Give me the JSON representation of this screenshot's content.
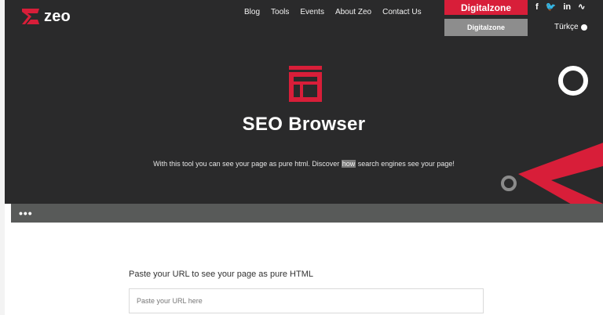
{
  "header": {
    "logo_text": "zeo",
    "nav": [
      "Blog",
      "Tools",
      "Events",
      "About Zeo",
      "Contact Us"
    ],
    "digitalzone_label": "Digitalzone",
    "digitalzone_sub_label": "Digitalzone",
    "social_icons": [
      "facebook-icon",
      "twitter-icon",
      "linkedin-icon",
      "rss-icon"
    ],
    "social_glyphs": [
      "f",
      "🐦",
      "in",
      "∿"
    ],
    "language": "Türkçe"
  },
  "hero": {
    "title": "SEO Browser",
    "subtitle_before": "With this tool you can see your page as pure html. Discover ",
    "subtitle_highlight": "how",
    "subtitle_after": " search engines see your page!"
  },
  "toolbar": {
    "dots": "•••"
  },
  "form": {
    "label": "Paste your URL to see your page as pure HTML",
    "placeholder": "Paste your URL here",
    "value": ""
  },
  "colors": {
    "hero_bg": "#2a2a2b",
    "brand_red": "#d81e39",
    "toolbar_bg": "#585a59",
    "gray_button": "#8d8d8d"
  }
}
